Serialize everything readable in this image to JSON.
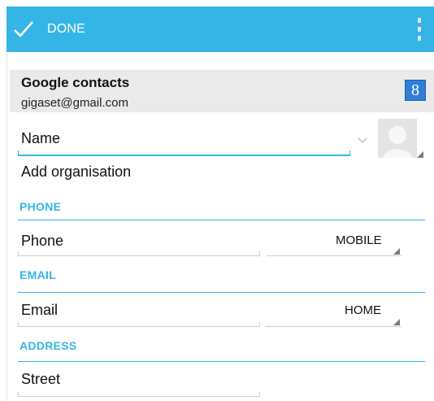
{
  "action_bar": {
    "done_label": "DONE",
    "done_icon": "check-icon",
    "overflow_icon": "overflow-menu-icon",
    "color": "#35b5e5"
  },
  "account": {
    "title": "Google contacts",
    "email": "gigaset@gmail.com",
    "badge_icon": "google-plus-icon",
    "badge_text": "8"
  },
  "fields": {
    "name_placeholder": "Name",
    "add_organisation": "Add organisation",
    "phone_placeholder": "Phone",
    "phone_type": "MOBILE",
    "email_placeholder": "Email",
    "email_type": "HOME",
    "street_placeholder": "Street"
  },
  "sections": {
    "phone": "PHONE",
    "email": "EMAIL",
    "address": "ADDRESS"
  },
  "accent_color": "#35b5e5"
}
